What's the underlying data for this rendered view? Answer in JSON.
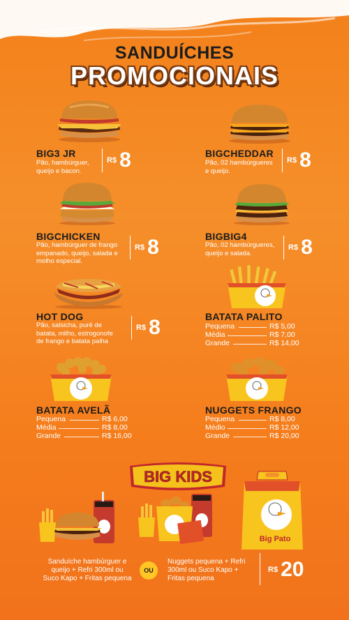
{
  "header": {
    "title_line1": "SANDUÍCHES",
    "title_line2": "PROMOCIONAIS"
  },
  "currency": "R$",
  "items": [
    {
      "name": "BIG3 JR",
      "desc": [
        "Pão, hambúrguer,",
        "queijo e bacon."
      ],
      "price": "8"
    },
    {
      "name": "BIGCHEDDAR",
      "desc": [
        "Pão, 02 hambúrgueres",
        "e queijo."
      ],
      "price": "8"
    },
    {
      "name": "BIGCHICKEN",
      "desc": [
        "Pão, hambúrguer de frango",
        "empanado, queijo, salada e",
        "molho especial."
      ],
      "price": "8"
    },
    {
      "name": "BIGBIG4",
      "desc": [
        "Pão, 02 hambúrgueres,",
        "queijo e salada."
      ],
      "price": "8"
    },
    {
      "name": "HOT DOG",
      "desc": [
        "Pão, salsicha, purê de",
        "batata, milho, estrogonofe",
        "de frango e batata palha"
      ],
      "price": "8"
    }
  ],
  "sized_items": [
    {
      "name": "BATATA PALITO",
      "sizes": [
        {
          "size": "Pequena",
          "price": "R$ 5,00"
        },
        {
          "size": "Média",
          "price": "R$ 7,00"
        },
        {
          "size": "Grande",
          "price": "R$ 14,00"
        }
      ]
    },
    {
      "name": "BATATA AVELÃ",
      "sizes": [
        {
          "size": "Pequena",
          "price": "R$ 6,00"
        },
        {
          "size": "Média",
          "price": "R$ 8,00"
        },
        {
          "size": "Grande",
          "price": "R$ 16,00"
        }
      ]
    },
    {
      "name": "NUGGETS FRANGO",
      "sizes": [
        {
          "size": "Pequena",
          "price": "R$ 8,00"
        },
        {
          "size": "Médio",
          "price": "R$ 12,00"
        },
        {
          "size": "Grande",
          "price": "R$ 20,00"
        }
      ]
    }
  ],
  "kids": {
    "logo": "BIG KIDS",
    "combo1": [
      "Sanduíche hambúrguer e",
      "queijo + Refri 300ml ou",
      "Suco Kapo + Fritas pequena"
    ],
    "or_label": "OU",
    "combo2": [
      "Nuggets pequena + Refri",
      "300ml ou Suco Kapo +",
      "Fritas pequena"
    ],
    "currency": "R$",
    "price": "20",
    "box_label": "Big Pato"
  },
  "colors": {
    "background": "#f58f2a",
    "title_white": "#ffffff",
    "name_dark": "#1b1b1b",
    "ou_badge": "#ffc626"
  }
}
